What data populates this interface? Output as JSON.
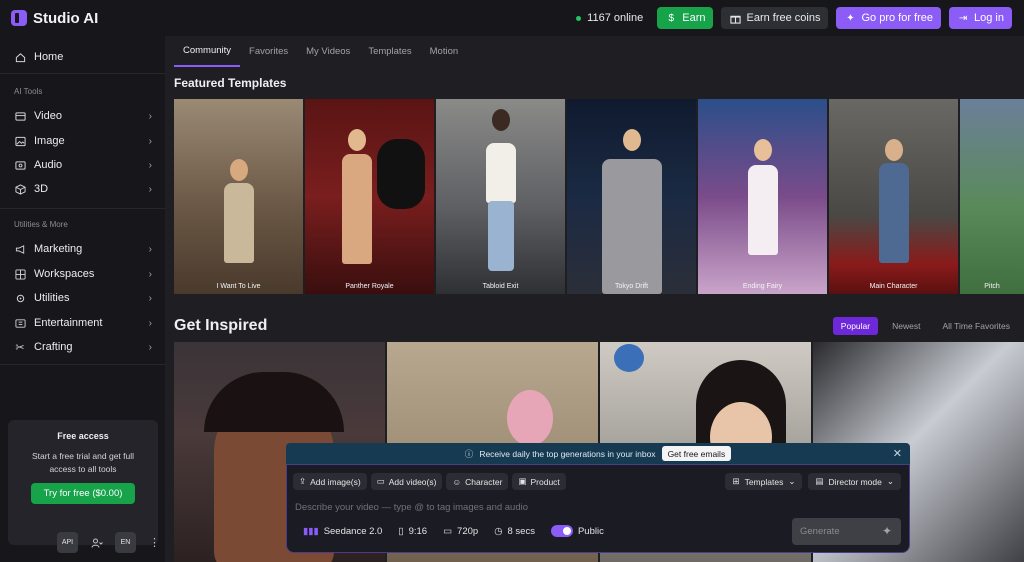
{
  "app": {
    "name": "Studio AI"
  },
  "header": {
    "online_count": "1167 online",
    "earn_label": "Earn",
    "earn_coins_label": "Earn free coins",
    "go_pro_label": "Go pro for free",
    "login_label": "Log in"
  },
  "sidebar": {
    "home": "Home",
    "ai_tools_label": "AI Tools",
    "ai_tools": [
      {
        "label": "Video",
        "icon": "video-icon"
      },
      {
        "label": "Image",
        "icon": "image-icon"
      },
      {
        "label": "Audio",
        "icon": "audio-icon"
      },
      {
        "label": "3D",
        "icon": "cube-icon"
      }
    ],
    "utilities_label": "Utilities & More",
    "utilities": [
      {
        "label": "Marketing",
        "icon": "megaphone-icon"
      },
      {
        "label": "Workspaces",
        "icon": "workspaces-icon"
      },
      {
        "label": "Utilities",
        "icon": "wrench-icon"
      },
      {
        "label": "Entertainment",
        "icon": "entertainment-icon"
      },
      {
        "label": "Crafting",
        "icon": "scissors-icon"
      }
    ],
    "promo": {
      "title": "Free access",
      "text": "Start a free trial and get full access to all tools",
      "button": "Try for free ($0.00)"
    },
    "bottom": {
      "api": "API",
      "lang": "EN"
    }
  },
  "tabs": [
    "Community",
    "Favorites",
    "My Videos",
    "Templates",
    "Motion"
  ],
  "featured": {
    "title": "Featured Templates",
    "items": [
      {
        "label": "I Want To Live"
      },
      {
        "label": "Panther Royale"
      },
      {
        "label": "Tabloid Exit"
      },
      {
        "label": "Tokyo Drift"
      },
      {
        "label": "Ending Fairy"
      },
      {
        "label": "Main Character"
      },
      {
        "label": "Pitch"
      }
    ]
  },
  "inspired": {
    "title": "Get Inspired",
    "sort": [
      "Popular",
      "Newest",
      "All Time Favorites"
    ]
  },
  "composer": {
    "notice_text": "Receive daily the top generations in your inbox",
    "notice_button": "Get free emails",
    "add_images": "Add image(s)",
    "add_videos": "Add video(s)",
    "character": "Character",
    "product": "Product",
    "templates": "Templates",
    "director_mode": "Director mode",
    "placeholder": "Describe your video — type @ to tag images and audio",
    "model": "Seedance 2.0",
    "aspect": "9:16",
    "resolution": "720p",
    "duration": "8 secs",
    "visibility": "Public",
    "generate": "Generate"
  },
  "colors": {
    "accent": "#8b5cf6",
    "earn_green": "#16a34a",
    "sidebar_bg": "#17171b",
    "main_bg": "#1f1f23"
  }
}
